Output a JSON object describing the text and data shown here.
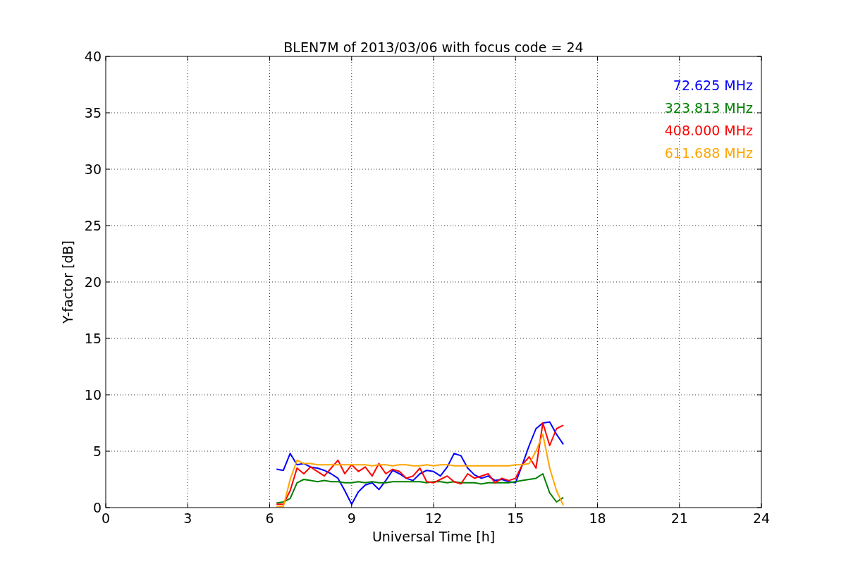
{
  "chart_data": {
    "type": "line",
    "title": "BLEN7M of 2013/03/06 with focus code = 24",
    "xlabel": "Universal Time [h]",
    "ylabel": "Y-factor [dB]",
    "xlim": [
      0,
      24
    ],
    "ylim": [
      0,
      40
    ],
    "xticks": [
      0,
      3,
      6,
      9,
      12,
      15,
      18,
      21,
      24
    ],
    "yticks": [
      0,
      5,
      10,
      15,
      20,
      25,
      30,
      35,
      40
    ],
    "grid": true,
    "x": [
      6.25,
      6.5,
      6.75,
      7,
      7.25,
      7.5,
      7.75,
      8,
      8.25,
      8.5,
      8.75,
      9,
      9.25,
      9.5,
      9.75,
      10,
      10.25,
      10.5,
      10.75,
      11,
      11.25,
      11.5,
      11.75,
      12,
      12.25,
      12.5,
      12.75,
      13,
      13.25,
      13.5,
      13.75,
      14,
      14.25,
      14.5,
      14.75,
      15,
      15.25,
      15.5,
      15.75,
      16,
      16.25,
      16.5,
      16.75
    ],
    "series": [
      {
        "name": "72.625 MHz",
        "color": "#0000ff",
        "values": [
          3.4,
          3.3,
          4.8,
          3.8,
          3.9,
          3.6,
          3.5,
          3.3,
          3.0,
          2.6,
          1.5,
          0.3,
          1.4,
          2.0,
          2.2,
          1.6,
          2.4,
          3.3,
          3.0,
          2.6,
          2.4,
          3.0,
          3.3,
          3.2,
          2.8,
          3.6,
          4.8,
          4.6,
          3.5,
          2.9,
          2.6,
          2.8,
          2.4,
          2.5,
          2.3,
          2.2,
          3.8,
          5.5,
          7.0,
          7.5,
          7.6,
          6.5,
          5.6
        ]
      },
      {
        "name": "323.813 MHz",
        "color": "#008000",
        "values": [
          0.4,
          0.5,
          0.8,
          2.2,
          2.5,
          2.4,
          2.3,
          2.4,
          2.3,
          2.3,
          2.2,
          2.2,
          2.3,
          2.2,
          2.3,
          2.2,
          2.2,
          2.3,
          2.3,
          2.3,
          2.3,
          2.3,
          2.2,
          2.3,
          2.3,
          2.2,
          2.3,
          2.2,
          2.2,
          2.2,
          2.1,
          2.2,
          2.2,
          2.2,
          2.2,
          2.3,
          2.4,
          2.5,
          2.6,
          3.0,
          1.3,
          0.5,
          0.9
        ]
      },
      {
        "name": "408.000 MHz",
        "color": "#ff0000",
        "values": [
          0.3,
          0.3,
          1.5,
          3.5,
          3.0,
          3.6,
          3.2,
          2.8,
          3.5,
          4.2,
          3.0,
          3.8,
          3.2,
          3.6,
          2.8,
          3.9,
          3.0,
          3.4,
          3.2,
          2.6,
          2.8,
          3.5,
          2.3,
          2.2,
          2.5,
          2.8,
          2.3,
          2.1,
          3.0,
          2.6,
          2.8,
          3.0,
          2.2,
          2.6,
          2.4,
          2.6,
          3.8,
          4.5,
          3.5,
          7.5,
          5.5,
          7.0,
          7.3
        ]
      },
      {
        "name": "611.688 MHz",
        "color": "#ffa500",
        "values": [
          0.1,
          0.1,
          2.5,
          4.2,
          3.9,
          3.9,
          3.8,
          3.8,
          3.8,
          3.8,
          3.8,
          3.8,
          3.8,
          3.8,
          3.7,
          3.8,
          3.8,
          3.7,
          3.8,
          3.8,
          3.7,
          3.7,
          3.8,
          3.7,
          3.8,
          3.8,
          3.7,
          3.7,
          3.7,
          3.7,
          3.7,
          3.7,
          3.7,
          3.7,
          3.7,
          3.8,
          3.8,
          3.9,
          5.0,
          6.5,
          3.5,
          1.5,
          0.2
        ]
      }
    ]
  }
}
